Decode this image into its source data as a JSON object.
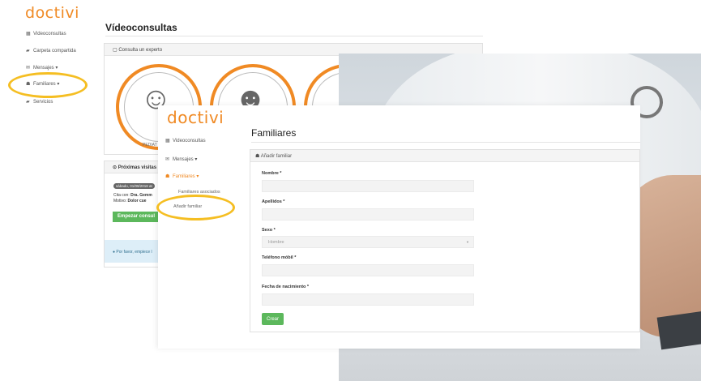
{
  "brand": {
    "logo_prefix": "d",
    "logo_oo": "oc",
    "logo_suffix": "tivi",
    "accent": "#f08a24",
    "highlight": "#f5be22"
  },
  "back": {
    "sidebar": [
      {
        "icon": "calendar-icon",
        "glyph": "▦",
        "label": "Videoconsultas"
      },
      {
        "icon": "folder-icon",
        "glyph": "▰",
        "label": "Carpeta compartida"
      },
      {
        "icon": "envelope-icon",
        "glyph": "✉",
        "label": "Mensajes ▾"
      },
      {
        "icon": "users-icon",
        "glyph": "☗",
        "label": "Familiares ▾"
      },
      {
        "icon": "folder-icon",
        "glyph": "▰",
        "label": "Servicios"
      }
    ],
    "page_title": "Vídeoconsultas",
    "experto_panel_title": "Consulta un experto",
    "specialty_caption": "PEDIAT",
    "proximas_title": "Próximas visitas",
    "visit_badge": "sábado, 01/09/2018 at",
    "visit_line1_prefix": "Cita con:",
    "visit_line1_doctor": "Dra. Gemm",
    "visit_line2_prefix": "Motivo:",
    "visit_line2_reason": "Dolor cue",
    "start_button": "Empezar consul",
    "info_text": "Por favor, empiece l"
  },
  "front": {
    "sidebar": [
      {
        "icon": "calendar-icon",
        "glyph": "▦",
        "label": "Videoconsultas"
      },
      {
        "icon": "envelope-icon",
        "glyph": "✉",
        "label": "Mensajes ▾"
      },
      {
        "icon": "users-icon",
        "glyph": "☗",
        "label": "Familiares ▾"
      }
    ],
    "sub_items": [
      "Familiares asociados",
      "Añadir familiar"
    ],
    "page_title": "Familiares",
    "panel_title": "Añadir familiar",
    "fields": {
      "nombre_label": "Nombre *",
      "apellidos_label": "Apellidos *",
      "sexo_label": "Sexo *",
      "sexo_value": "Hombre",
      "telefono_label": "Teléfono móbil *",
      "fecha_label": "Fecha de nacimiento *"
    },
    "submit_button": "Crear"
  }
}
